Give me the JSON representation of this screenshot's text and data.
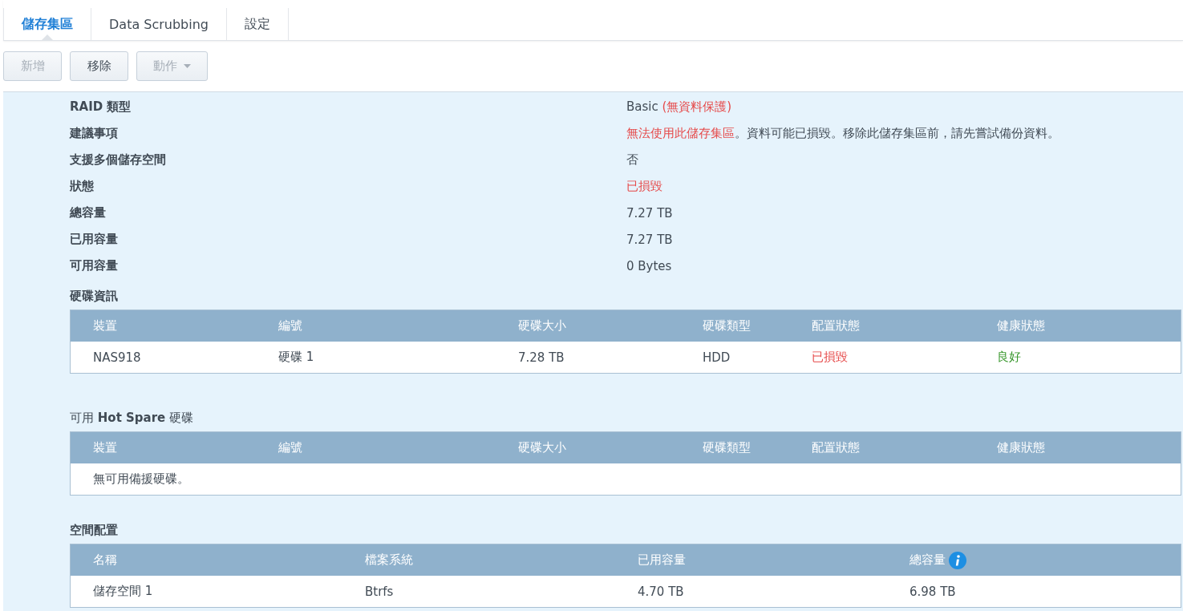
{
  "tabs": [
    {
      "label": "儲存集區",
      "selected": true
    },
    {
      "label": "Data Scrubbing",
      "selected": false
    },
    {
      "label": "設定",
      "selected": false
    }
  ],
  "toolbar": [
    {
      "label": "新增",
      "disabled": true,
      "kind": "button"
    },
    {
      "label": "移除",
      "disabled": false,
      "kind": "button"
    },
    {
      "label": "動作",
      "disabled": true,
      "kind": "dropdown"
    }
  ],
  "info": [
    {
      "label": "RAID 類型",
      "value": [
        {
          "text": "Basic "
        },
        {
          "text": "(無資料保護)",
          "color": "#e64a4a"
        }
      ]
    },
    {
      "label": "建議事項",
      "value": [
        {
          "text": "無法使用此儲存集區",
          "color": "#e64a4a"
        },
        {
          "text": "。資料可能已損毀。移除此儲存集區前，請先嘗試備份資料。"
        }
      ]
    },
    {
      "label": "支援多個儲存空間",
      "value": [
        {
          "text": "否"
        }
      ]
    },
    {
      "label": "狀態",
      "value": [
        {
          "text": "已損毀",
          "color": "#e64a4a"
        }
      ]
    },
    {
      "label": "總容量",
      "value": [
        {
          "text": "7.27 TB"
        }
      ]
    },
    {
      "label": "已用容量",
      "value": [
        {
          "text": "7.27 TB"
        }
      ]
    },
    {
      "label": "可用容量",
      "value": [
        {
          "text": "0 Bytes"
        }
      ]
    }
  ],
  "disk_info": {
    "title": "硬碟資訊",
    "columns": [
      "裝置",
      "編號",
      "硬碟大小",
      "硬碟類型",
      "配置狀態",
      "健康狀態"
    ],
    "rows": [
      [
        {
          "text": "NAS918"
        },
        {
          "text": "硬碟 1"
        },
        {
          "text": "7.28 TB"
        },
        {
          "text": "HDD"
        },
        {
          "text": "已損毀",
          "color": "#e64a4a"
        },
        {
          "text": "良好",
          "color": "#36962a"
        }
      ]
    ]
  },
  "hot_spare": {
    "title": "可用 **Hot Spare** 硬碟",
    "columns": [
      "裝置",
      "編號",
      "硬碟大小",
      "硬碟類型",
      "配置狀態",
      "健康狀態"
    ],
    "empty_message": "無可用備援硬碟。"
  },
  "volumes": {
    "title": "空間配置",
    "columns": [
      {
        "label": "名稱",
        "info": false
      },
      {
        "label": "檔案系統",
        "info": false
      },
      {
        "label": "已用容量",
        "info": false
      },
      {
        "label": "總容量",
        "info": true
      }
    ],
    "rows": [
      [
        {
          "text": "儲存空間 1"
        },
        {
          "text": "Btrfs"
        },
        {
          "text": "4.70 TB"
        },
        {
          "text": "6.98 TB"
        }
      ]
    ]
  }
}
